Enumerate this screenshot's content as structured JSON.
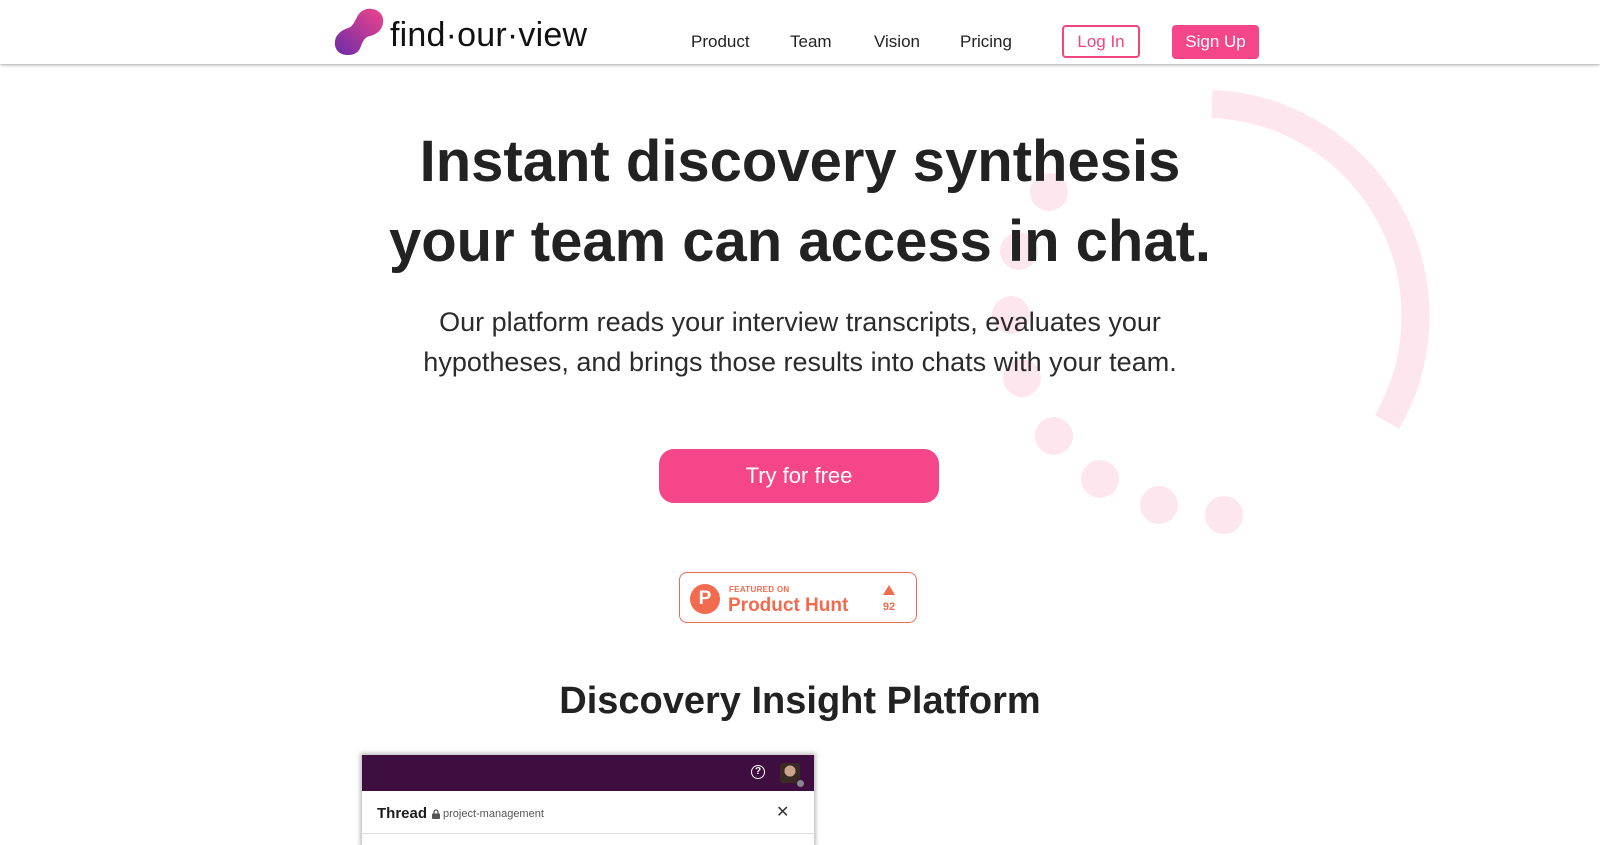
{
  "brand": {
    "name": "find·our·view",
    "gradient_start": "#6a2ca8",
    "gradient_end": "#f0448a"
  },
  "nav": {
    "links": [
      {
        "label": "Product"
      },
      {
        "label": "Team"
      },
      {
        "label": "Vision"
      },
      {
        "label": "Pricing"
      }
    ],
    "login_label": "Log In",
    "signup_label": "Sign Up"
  },
  "hero": {
    "title_line1": "Instant discovery synthesis",
    "title_line2": "your team can access in chat.",
    "subtitle_line1": "Our platform reads your interview transcripts, evaluates your",
    "subtitle_line2": "hypotheses, and brings those results into chats with your team.",
    "cta_label": "Try for free"
  },
  "product_hunt": {
    "featured_label": "FEATURED ON",
    "name": "Product Hunt",
    "logo_letter": "P",
    "upvotes": "92"
  },
  "section": {
    "title": "Discovery Insight Platform"
  },
  "mockup": {
    "thread_label": "Thread",
    "channel_name": "project-management",
    "help_symbol": "?",
    "close_symbol": "✕",
    "icons": [
      "help-icon",
      "avatar",
      "lock-icon",
      "close-icon"
    ]
  },
  "colors": {
    "accent": "#f44688",
    "decoration": "#fde6ee",
    "product_hunt": "#f26b4f",
    "slack_purple": "#3f0e40"
  }
}
